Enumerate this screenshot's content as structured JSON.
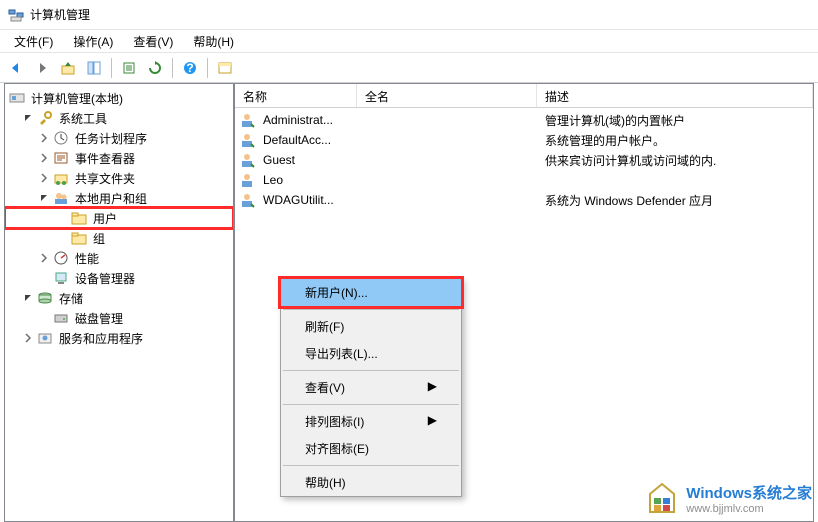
{
  "window": {
    "title": "计算机管理"
  },
  "menubar": [
    {
      "label": "文件(F)"
    },
    {
      "label": "操作(A)"
    },
    {
      "label": "查看(V)"
    },
    {
      "label": "帮助(H)"
    }
  ],
  "tree": {
    "root": "计算机管理(本地)",
    "system_tools": "系统工具",
    "task_scheduler": "任务计划程序",
    "event_viewer": "事件查看器",
    "shared_folders": "共享文件夹",
    "local_users": "本地用户和组",
    "users": "用户",
    "groups": "组",
    "performance": "性能",
    "device_manager": "设备管理器",
    "storage": "存储",
    "disk_management": "磁盘管理",
    "services_apps": "服务和应用程序"
  },
  "columns": {
    "name": "名称",
    "fullname": "全名",
    "description": "描述"
  },
  "users": [
    {
      "name": "Administrat...",
      "fullname": "",
      "desc": "管理计算机(域)的内置帐户"
    },
    {
      "name": "DefaultAcc...",
      "fullname": "",
      "desc": "系统管理的用户帐户。"
    },
    {
      "name": "Guest",
      "fullname": "",
      "desc": "供来宾访问计算机或访问域的内."
    },
    {
      "name": "Leo",
      "fullname": "",
      "desc": ""
    },
    {
      "name": "WDAGUtilit...",
      "fullname": "",
      "desc": "系统为 Windows Defender 应月"
    }
  ],
  "context_menu": {
    "new_user": "新用户(N)...",
    "refresh": "刷新(F)",
    "export_list": "导出列表(L)...",
    "view": "查看(V)",
    "arrange_icons": "排列图标(I)",
    "align_icons": "对齐图标(E)",
    "help": "帮助(H)"
  },
  "watermark": {
    "brand": "Windows系统之家",
    "url": "www.bjjmlv.com"
  }
}
